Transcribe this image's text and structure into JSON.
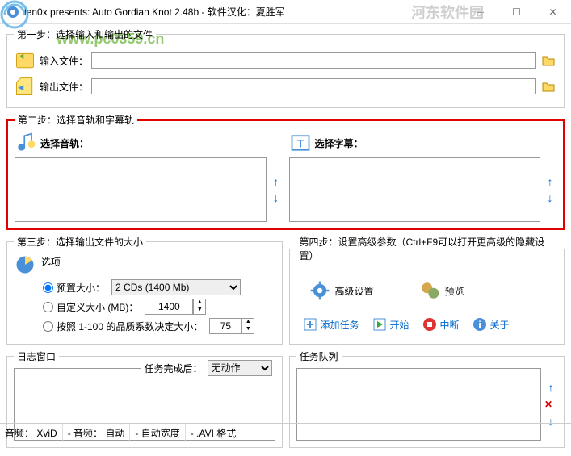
{
  "window": {
    "title": "len0x presents: Auto Gordian Knot 2.48b - 软件汉化：夏胜军"
  },
  "watermark": {
    "url": "www.pc0359.cn",
    "corner": "河东软件园"
  },
  "step1": {
    "legend": "第一步：选择输入和输出的文件",
    "input_label": "输入文件：",
    "output_label": "输出文件：",
    "input_value": "",
    "output_value": ""
  },
  "step2": {
    "legend": "第二步：选择音轨和字幕轨",
    "audio_label": "选择音轨：",
    "subtitle_label": "选择字幕：",
    "up": "↑",
    "down": "↓"
  },
  "step3": {
    "legend": "第三步：选择输出文件的大小",
    "options_label": "选项",
    "preset_label": "预置大小：",
    "preset_select": "2 CDs  (1400 Mb)",
    "custom_label": "自定义大小 (MB)：",
    "custom_value": "1400",
    "quality_label": "按照 1-100 的品质系数决定大小：",
    "quality_value": "75"
  },
  "step4": {
    "legend": "第四步：设置高级参数（Ctrl+F9可以打开更高级的隐藏设置）",
    "advanced": "高级设置",
    "preview": "预览"
  },
  "actions": {
    "add": "添加任务",
    "start": "开始",
    "stop": "中断",
    "about": "关于"
  },
  "log": {
    "legend": "日志窗口",
    "after_label": "任务完成后：",
    "after_value": "无动作"
  },
  "queue": {
    "legend": "任务队列"
  },
  "status": {
    "video_label": "音频：",
    "video_value": "XviD",
    "audio_label": "音频：",
    "audio_value": "自动",
    "width_label": "自动宽度",
    "format": ".AVI 格式"
  }
}
